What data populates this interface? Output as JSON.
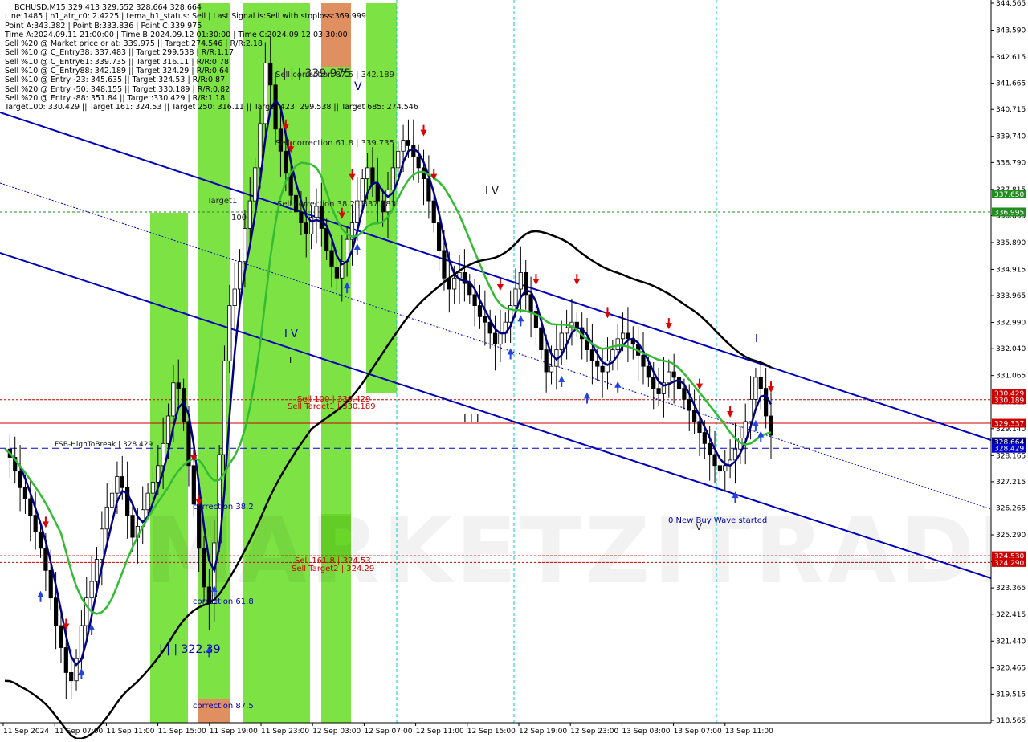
{
  "header": {
    "symbol_line": "BCHUSD,M15  329.413 329.552 328.664 328.664",
    "lines": [
      "Line:1485 | h1_atr_c0: 2.4225 | tema_h1_status: Sell | Last Signal is:Sell with stoploss:369.999",
      "Point A:343.382 | Point B:333.836 | Point C:339.975",
      "Time A:2024.09.11 21:00:00 | Time B:2024.09.12 01:30:00 | Time C:2024.09.12 03:30:00",
      "Sell %20 @ Market price or at: 339.975 || Target:274.546 | R/R:2.18",
      "Sell %10 @ C_Entry38: 337.483 || Target:299.538 | R/R:1.17",
      "Sell %10 @ C_Entry61: 339.735 || Target:316.11 | R/R:0.78",
      "Sell %10 @ C_Entry88: 342.189 || Target:324.29 | R/R:0.64",
      "Sell %10 @ Entry -23: 345.635 || Target:324.53 | R/R:0.87",
      "Sell %20 @ Entry -50: 348.155 || Target:330.189 | R/R:0.82",
      "Sell %20 @ Entry -88: 351.84 || Target:330.429 | R/R:1.18",
      "Target100: 330.429 || Target 161: 324.53 || Target 250: 316.11 || Target 423: 299.538 || Target 685: 274.546"
    ]
  },
  "watermark": "MARKETZITRADE",
  "colors": {
    "green_zone": "#66dd22",
    "orange_zone": "#e09060",
    "blue_line": "#0000bb",
    "dark_line": "#000000",
    "ma_green": "#33bb33",
    "red": "#cc0000",
    "navy": "#000080"
  },
  "chart_data": {
    "type": "candlestick",
    "symbol": "BCHUSD",
    "timeframe": "M15",
    "ylim": [
      318.565,
      344.565
    ],
    "y_ticks": [
      "344.565",
      "343.590",
      "342.615",
      "341.665",
      "340.715",
      "339.740",
      "338.790",
      "337.815",
      "336.865",
      "335.890",
      "334.915",
      "333.965",
      "332.990",
      "332.040",
      "331.065",
      "330.115",
      "329.140",
      "328.165",
      "327.215",
      "326.265",
      "325.290",
      "324.315",
      "323.365",
      "322.415",
      "321.440",
      "320.465",
      "319.515",
      "318.565"
    ],
    "x_ticks": [
      "11 Sep 2024",
      "11 Sep 07:00",
      "11 Sep 11:00",
      "11 Sep 15:00",
      "11 Sep 19:00",
      "11 Sep 23:00",
      "12 Sep 03:00",
      "12 Sep 07:00",
      "12 Sep 11:00",
      "12 Sep 15:00",
      "12 Sep 19:00",
      "12 Sep 23:00",
      "13 Sep 03:00",
      "13 Sep 07:00",
      "13 Sep 11:00"
    ],
    "price_badges": [
      {
        "label": "337.650",
        "value": 337.65,
        "color": "#228B22"
      },
      {
        "label": "336.995",
        "value": 336.995,
        "color": "#228B22"
      },
      {
        "label": "330.429",
        "value": 330.429,
        "color": "#cc0000"
      },
      {
        "label": "330.189",
        "value": 330.189,
        "color": "#cc0000"
      },
      {
        "label": "329.337",
        "value": 329.337,
        "color": "#cc0000"
      },
      {
        "label": "328.664",
        "value": 328.664,
        "color": "#000080"
      },
      {
        "label": "328.429",
        "value": 328.429,
        "color": "#0000cc"
      },
      {
        "label": "324.530",
        "value": 324.53,
        "color": "#cc0000"
      },
      {
        "label": "324.290",
        "value": 324.29,
        "color": "#cc0000"
      }
    ],
    "annotations": [
      {
        "text": "| | | 339.975",
        "value": 339.975
      },
      {
        "text": "Sell correction 87.5 | 342.189",
        "value": 342.189
      },
      {
        "text": "V",
        "value": 341.5
      },
      {
        "text": "Sell correction 61.8 | 339.735",
        "value": 339.735
      },
      {
        "text": "Sell correction 38.2 | 337.483",
        "value": 337.483
      },
      {
        "text": "Target1",
        "value": 337.6
      },
      {
        "text": "100",
        "value": 336.8
      },
      {
        "text": "I V",
        "value": 337.9
      },
      {
        "text": "I V",
        "value": 333.0
      },
      {
        "text": "I",
        "value": 332.2
      },
      {
        "text": "I I I",
        "value": 329.8
      },
      {
        "text": "I",
        "value": 333.5
      },
      {
        "text": "Sell 100 | 330.429",
        "value": 330.429
      },
      {
        "text": "Sell Target1 | 330.189",
        "value": 330.189
      },
      {
        "text": "FSB-HighToBreak | 328.429",
        "value": 328.429
      },
      {
        "text": "correction 38.2",
        "value": 326.3
      },
      {
        "text": "Sell 161.8 | 324.53",
        "value": 324.53
      },
      {
        "text": "Sell Target2 | 324.29",
        "value": 324.29
      },
      {
        "text": "correction 61.8",
        "value": 322.8
      },
      {
        "text": "| | | 322.39",
        "value": 322.39
      },
      {
        "text": "correction 87.5",
        "value": 319.0
      },
      {
        "text": "0 New Buy Wave started",
        "value": 325.8
      },
      {
        "text": "V",
        "value": 325.6
      }
    ],
    "close_series": [
      328.4,
      328.1,
      327.6,
      327.0,
      326.6,
      326.0,
      325.4,
      324.8,
      324.0,
      323.0,
      322.0,
      321.2,
      320.3,
      320.0,
      320.8,
      322.0,
      323.0,
      323.6,
      324.4,
      325.5,
      326.3,
      326.8,
      327.4,
      327.0,
      326.0,
      325.2,
      325.6,
      326.2,
      326.8,
      327.2,
      327.8,
      328.6,
      329.6,
      330.8,
      330.6,
      329.4,
      327.8,
      326.4,
      324.8,
      323.4,
      322.8,
      325.0,
      328.2,
      331.6,
      333.6,
      334.2,
      335.2,
      336.4,
      337.4,
      338.6,
      340.2,
      342.4,
      341.6,
      340.0,
      339.2,
      338.4,
      337.6,
      337.0,
      336.6,
      336.2,
      336.8,
      337.2,
      336.4,
      335.6,
      335.0,
      334.6,
      335.2,
      336.0,
      336.6,
      337.4,
      338.2,
      338.6,
      338.0,
      337.4,
      337.0,
      337.8,
      338.6,
      339.2,
      339.6,
      339.4,
      339.0,
      338.6,
      338.2,
      337.4,
      336.6,
      335.6,
      334.6,
      334.2,
      334.6,
      334.8,
      334.4,
      334.0,
      333.6,
      333.2,
      333.0,
      332.6,
      332.2,
      332.6,
      333.0,
      333.6,
      334.2,
      334.8,
      334.0,
      333.4,
      332.8,
      332.0,
      331.2,
      331.4,
      332.0,
      332.6,
      332.8,
      333.0,
      332.8,
      332.4,
      332.0,
      331.6,
      331.4,
      331.2,
      331.6,
      332.0,
      332.4,
      332.6,
      332.4,
      332.2,
      331.8,
      331.4,
      331.0,
      330.6,
      330.4,
      330.8,
      331.2,
      331.0,
      330.6,
      330.2,
      329.8,
      329.4,
      329.0,
      328.6,
      328.2,
      327.8,
      327.6,
      327.8,
      328.0,
      328.4,
      328.8,
      329.4,
      330.2,
      331.0,
      330.6,
      329.6,
      328.9
    ]
  }
}
